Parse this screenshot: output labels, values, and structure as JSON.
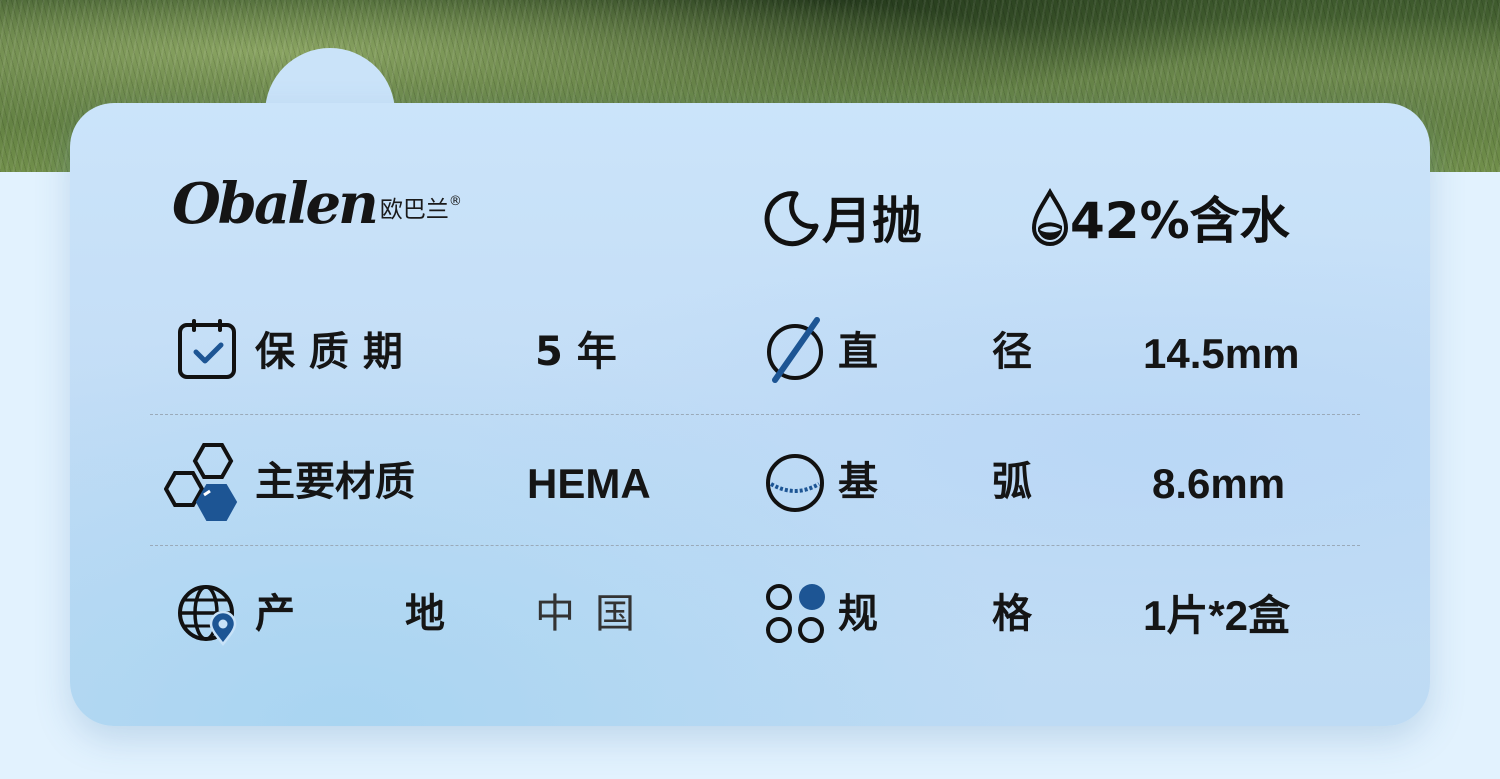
{
  "brand": {
    "name_en": "Obalen",
    "name_cn": "欧巴兰",
    "reg_mark": "®"
  },
  "header": {
    "period": {
      "icon": "moon-icon",
      "text": "月抛"
    },
    "water": {
      "icon": "water-drop-icon",
      "text": "42%含水"
    }
  },
  "specs": {
    "shelf_life": {
      "icon": "calendar-check-icon",
      "label": "保 质 期",
      "value": "5 年"
    },
    "diameter": {
      "icon": "diameter-icon",
      "label_a": "直",
      "label_b": "径",
      "value": "14.5mm"
    },
    "material": {
      "icon": "hexagon-molecule-icon",
      "label": "主要材质",
      "value": "HEMA"
    },
    "base_curve": {
      "icon": "base-curve-icon",
      "label_a": "基",
      "label_b": "弧",
      "value": "8.6mm"
    },
    "origin": {
      "icon": "globe-location-icon",
      "label_a": "产",
      "label_b": "地",
      "value": "中国"
    },
    "spec": {
      "icon": "four-dots-icon",
      "label_a": "规",
      "label_b": "格",
      "value": "1片*2盒"
    }
  },
  "colors": {
    "accent": "#1d5594",
    "text": "#151515",
    "card": "#c8e2f8"
  }
}
